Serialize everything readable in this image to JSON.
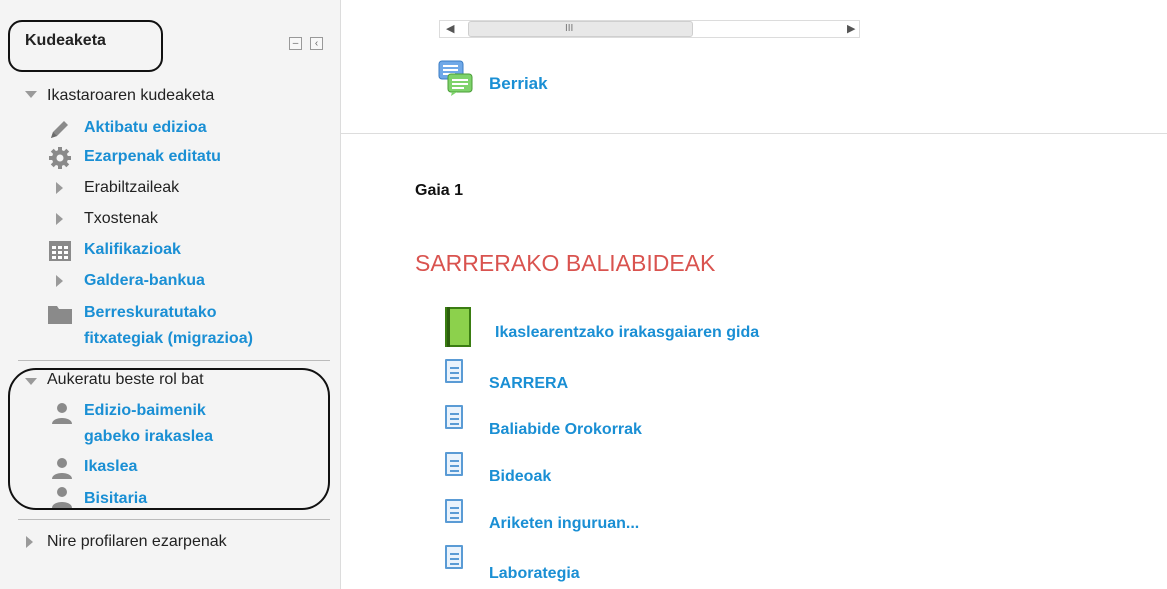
{
  "sidebar": {
    "title": "Kudeaketa",
    "collapse_icon": "minus",
    "dock_icon": "chevron-left",
    "course_admin_label": "Ikastaroaren kudeaketa",
    "items": [
      {
        "label": "Aktibatu edizioa",
        "icon": "pencil-icon"
      },
      {
        "label": "Ezarpenak editatu",
        "icon": "gear-icon"
      },
      {
        "label": "Erabiltzaileak",
        "icon": "triangle-right-icon"
      },
      {
        "label": "Txostenak",
        "icon": "triangle-right-icon"
      },
      {
        "label": "Kalifikazioak",
        "icon": "grades-table-icon"
      },
      {
        "label": "Galdera-bankua",
        "icon": "triangle-right-icon"
      },
      {
        "label": "Berreskuratutako fitxategiak (migrazioa)",
        "label_line1": "Berreskuratutako",
        "label_line2": "fitxategiak (migrazioa)",
        "icon": "folder-icon"
      }
    ],
    "switch_role": {
      "label": "Aukeratu beste rol bat",
      "roles": [
        {
          "label": "Edizio-baimenik gabeko irakaslea",
          "label_line1": "Edizio-baimenik",
          "label_line2": "gabeko irakaslea",
          "icon": "user-icon"
        },
        {
          "label": "Ikaslea",
          "icon": "user-icon"
        },
        {
          "label": "Bisitaria",
          "icon": "user-icon"
        }
      ]
    },
    "profile_settings_label": "Nire profilaren ezarpenak"
  },
  "main": {
    "scroll_thumb_glyph": "III",
    "news_link": "Berriak",
    "section_label": "Gaia 1",
    "section_heading": "SARRERAKO BALIABIDEAK",
    "resources": [
      {
        "label": "Ikaslearentzako irakasgaiaren gida",
        "icon": "book-icon"
      },
      {
        "label": "SARRERA",
        "icon": "page-icon"
      },
      {
        "label": "Baliabide Orokorrak",
        "icon": "page-icon"
      },
      {
        "label": "Bideoak",
        "icon": "page-icon"
      },
      {
        "label": "Ariketen inguruan...",
        "icon": "page-icon"
      },
      {
        "label": "Laborategia",
        "icon": "page-icon"
      }
    ]
  },
  "colors": {
    "link": "#1a8fd4",
    "heading_red": "#d9534f",
    "sidebar_bg": "#f4f4f4"
  }
}
